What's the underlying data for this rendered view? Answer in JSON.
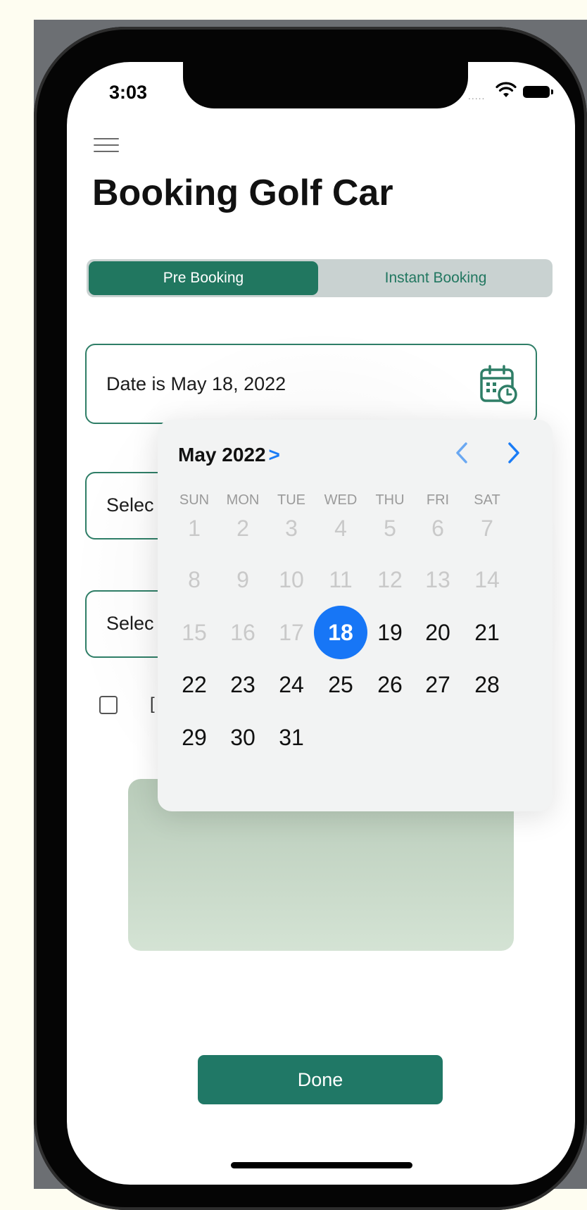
{
  "status_bar": {
    "time": "3:03",
    "signal": "....."
  },
  "header": {
    "title": "Booking Golf Car"
  },
  "tabs": [
    {
      "label": "Pre Booking",
      "active": true
    },
    {
      "label": "Instant Booking",
      "active": false
    }
  ],
  "form": {
    "date_field": "Date is May 18, 2022",
    "select_1": "Selec",
    "select_2": "Selec",
    "checkbox_label": "[",
    "done_label": "Done"
  },
  "calendar": {
    "month_label": "May 2022",
    "month_chevron": ">",
    "weekdays": [
      "SUN",
      "MON",
      "TUE",
      "WED",
      "THU",
      "FRI",
      "SAT"
    ],
    "days": [
      {
        "d": "1",
        "state": "disabled"
      },
      {
        "d": "2",
        "state": "disabled"
      },
      {
        "d": "3",
        "state": "disabled"
      },
      {
        "d": "4",
        "state": "disabled"
      },
      {
        "d": "5",
        "state": "disabled"
      },
      {
        "d": "6",
        "state": "disabled"
      },
      {
        "d": "7",
        "state": "disabled"
      },
      {
        "d": "8",
        "state": "disabled"
      },
      {
        "d": "9",
        "state": "disabled"
      },
      {
        "d": "10",
        "state": "disabled"
      },
      {
        "d": "11",
        "state": "disabled"
      },
      {
        "d": "12",
        "state": "disabled"
      },
      {
        "d": "13",
        "state": "disabled"
      },
      {
        "d": "14",
        "state": "disabled"
      },
      {
        "d": "15",
        "state": "disabled"
      },
      {
        "d": "16",
        "state": "disabled"
      },
      {
        "d": "17",
        "state": "disabled"
      },
      {
        "d": "18",
        "state": "selected"
      },
      {
        "d": "19",
        "state": "enabled"
      },
      {
        "d": "20",
        "state": "enabled"
      },
      {
        "d": "21",
        "state": "enabled"
      },
      {
        "d": "22",
        "state": "enabled"
      },
      {
        "d": "23",
        "state": "enabled"
      },
      {
        "d": "24",
        "state": "enabled"
      },
      {
        "d": "25",
        "state": "enabled"
      },
      {
        "d": "26",
        "state": "enabled"
      },
      {
        "d": "27",
        "state": "enabled"
      },
      {
        "d": "28",
        "state": "enabled"
      },
      {
        "d": "29",
        "state": "enabled"
      },
      {
        "d": "30",
        "state": "enabled"
      },
      {
        "d": "31",
        "state": "enabled"
      }
    ]
  },
  "colors": {
    "brand_green": "#217760",
    "segment_bg": "#c9d2d1",
    "selected_blue": "#1776f6",
    "preview_gradient_top": "#b8cbb9",
    "preview_gradient_bottom": "#d4e3d4"
  }
}
